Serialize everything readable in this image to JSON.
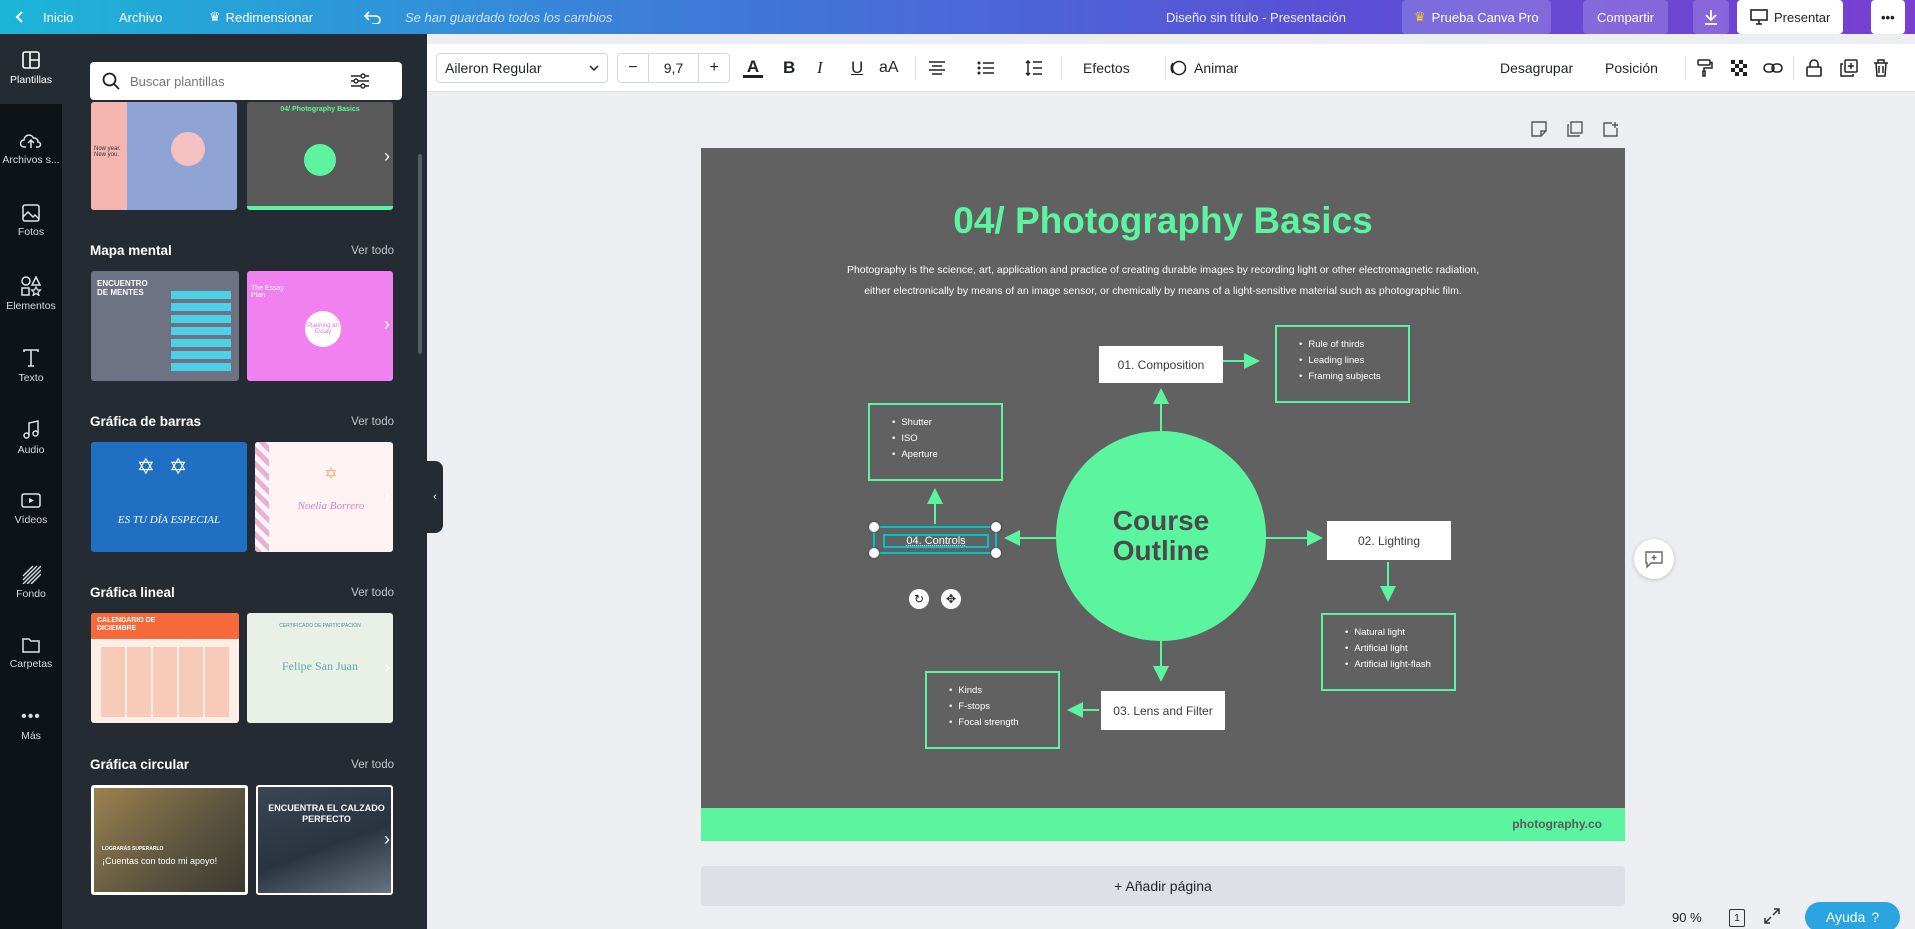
{
  "topbar": {
    "home": "Inicio",
    "file": "Archivo",
    "resize": "Redimensionar",
    "status": "Se han guardado todos los cambios",
    "doc_title": "Diseño sin título - Presentación",
    "pro": "Prueba Canva Pro",
    "share": "Compartir",
    "present": "Presentar"
  },
  "rail": [
    {
      "label": "Plantillas",
      "icon": "layout-icon"
    },
    {
      "label": "Archivos s...",
      "icon": "cloud-upload-icon"
    },
    {
      "label": "Fotos",
      "icon": "image-icon"
    },
    {
      "label": "Elementos",
      "icon": "shapes-icon"
    },
    {
      "label": "Texto",
      "icon": "text-icon"
    },
    {
      "label": "Audio",
      "icon": "music-icon"
    },
    {
      "label": "Vídeos",
      "icon": "video-icon"
    },
    {
      "label": "Fondo",
      "icon": "pattern-icon"
    },
    {
      "label": "Carpetas",
      "icon": "folder-icon"
    },
    {
      "label": "Más",
      "icon": "more-icon"
    }
  ],
  "panel": {
    "search_placeholder": "Buscar plantillas",
    "see_all": "Ver todo",
    "sections": [
      "Mapa mental",
      "Gráfica de barras",
      "Gráfica lineal",
      "Gráfica circular"
    ],
    "thumbs": {
      "t1a": "Now year. New you.",
      "t1b": "04/ Photography Basics",
      "t2a": "ENCUENTRO DE MENTES",
      "t2b": "The Essay Plan",
      "t2b_center": "Planning an Essay",
      "t3a": "ES TU DÍA ESPECIAL",
      "t3b": "Noelia Borrero",
      "t4a": "CALENDARIO DE DICIEMBRE",
      "t4b_center": "Felipe San Juan",
      "t4b_top": "CERTIFICADO DE PARTICIPACIÓN",
      "t5a": "¡Cuentas con todo mi apoyo!",
      "t5a_small": "LOGRARÁS SUPERARLO",
      "t5b": "ENCUENTRA EL CALZADO PERFECTO"
    }
  },
  "toolbar": {
    "font": "Aileron Regular",
    "size": "9,7",
    "effects": "Efectos",
    "animate": "Animar",
    "ungroup": "Desagrupar",
    "position": "Posición"
  },
  "slide": {
    "title": "04/ Photography Basics",
    "desc1": "Photography is the science, art, application and practice of creating durable images by recording light or other electromagnetic radiation,",
    "desc2": "either electronically by means of an image sensor, or chemically by means of a light-sensitive material such as photographic film.",
    "center1": "Course",
    "center2": "Outline",
    "b1": "01. Composition",
    "b2": "02. Lighting",
    "b3": "03. Lens and Filter",
    "b4": "04. Controls",
    "l1": [
      "Rule of thirds",
      "Leading lines",
      "Framing subjects"
    ],
    "l2": [
      "Natural light",
      "Artificial light",
      "Artificial light-flash"
    ],
    "l3": [
      "Kinds",
      "F-stops",
      "Focal strength"
    ],
    "l4": [
      "Shutter",
      "ISO",
      "Aperture"
    ],
    "footer": "photography.co"
  },
  "add_page": "+ Añadir página",
  "zoom": "90 %",
  "page_num": "1",
  "help": "Ayuda",
  "colors": {
    "accent": "#5cf59f",
    "slide_bg": "#616161",
    "panel": "#252b33",
    "rail": "#0e1318"
  }
}
